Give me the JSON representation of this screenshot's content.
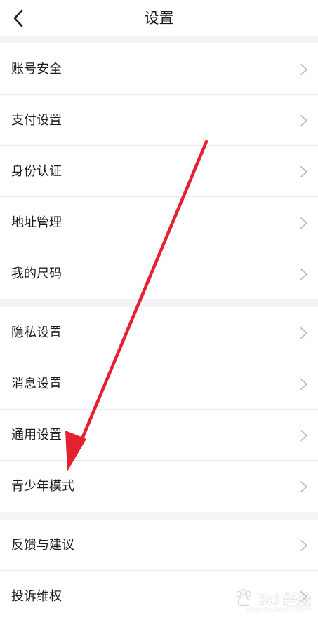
{
  "header": {
    "title": "设置",
    "back_icon": "chevron-left-icon"
  },
  "groups": [
    {
      "items": [
        {
          "label": "账号安全"
        },
        {
          "label": "支付设置"
        },
        {
          "label": "身份认证"
        },
        {
          "label": "地址管理"
        },
        {
          "label": "我的尺码"
        }
      ]
    },
    {
      "items": [
        {
          "label": "隐私设置"
        },
        {
          "label": "消息设置"
        },
        {
          "label": "通用设置"
        },
        {
          "label": "青少年模式"
        }
      ]
    },
    {
      "items": [
        {
          "label": "反馈与建议"
        },
        {
          "label": "投诉维权"
        }
      ]
    }
  ],
  "annotation": {
    "arrow_color": "#e3212f"
  },
  "watermark": {
    "text": "Bai 经验",
    "sub": "jingyan.baidu.com"
  },
  "colors": {
    "background": "#f4f4f8",
    "surface": "#ffffff",
    "divider": "#ececf0",
    "text": "#1c1c1e",
    "chevron": "#b9b9be"
  }
}
